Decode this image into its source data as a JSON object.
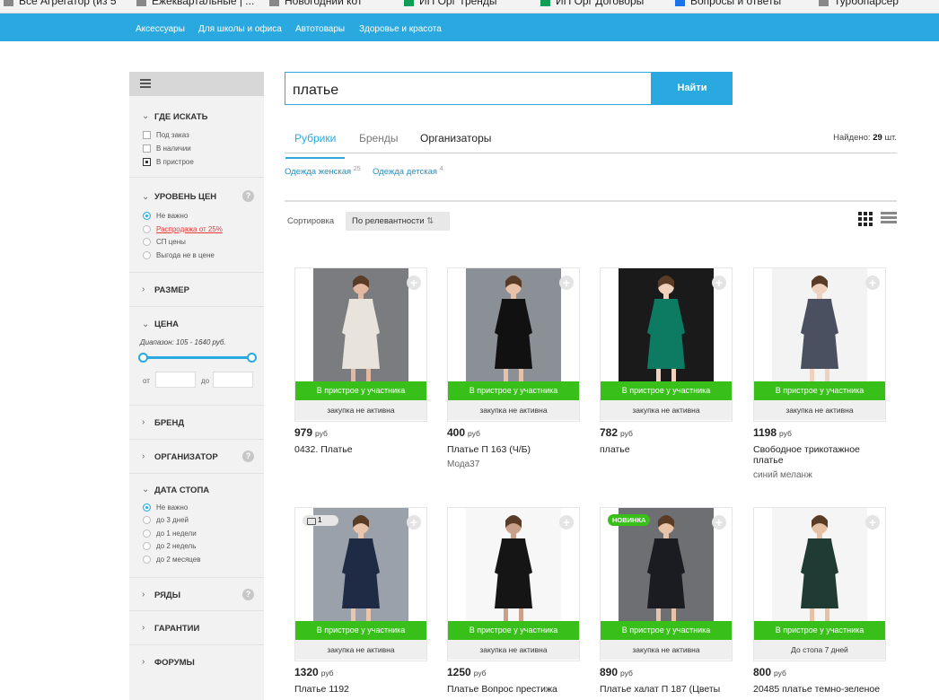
{
  "bookmarks": [
    {
      "label": "Все Агрегатор (из 5",
      "color": "#888"
    },
    {
      "label": "Ежеквартальные | ...",
      "color": "#888"
    },
    {
      "label": "Новогодний кот",
      "color": "#888"
    },
    {
      "label": "ИП Орг Тренды",
      "color": "#0f9d58"
    },
    {
      "label": "ИП Орг Договоры",
      "color": "#0f9d58"
    },
    {
      "label": "Вопросы и ответы",
      "color": "#1a73e8"
    },
    {
      "label": "Турбопарсер",
      "color": "#888"
    }
  ],
  "nav": {
    "items": [
      "Аксессуары",
      "Для школы и офиса",
      "Автотовары",
      "Здоровье и красота"
    ]
  },
  "sidebar": {
    "where": {
      "title": "ГДЕ ИСКАТЬ",
      "options": [
        {
          "label": "Под заказ",
          "checked": false
        },
        {
          "label": "В наличии",
          "checked": false
        },
        {
          "label": "В пристрое",
          "checked": true
        }
      ]
    },
    "price_level": {
      "title": "УРОВЕНЬ ЦЕН",
      "help": "?",
      "options": [
        {
          "label": "Не важно",
          "selected": true
        },
        {
          "label": "Распродажа от 25%",
          "selected": false
        },
        {
          "label": "СП цены",
          "selected": false
        },
        {
          "label": "Выгода не в цене",
          "selected": false
        }
      ]
    },
    "size": {
      "title": "РАЗМЕР"
    },
    "price": {
      "title": "ЦЕНА",
      "range_note": "Диапазон: 105 - 1640 руб.",
      "min": 105,
      "max": 1640,
      "from_label": "от",
      "to_label": "до",
      "from_value": "",
      "to_value": ""
    },
    "brand": {
      "title": "БРЕНД"
    },
    "organizer": {
      "title": "ОРГАНИЗАТОР",
      "help": "?"
    },
    "stop_date": {
      "title": "ДАТА СТОПА",
      "options": [
        {
          "label": "Не важно",
          "selected": true
        },
        {
          "label": "до 3 дней",
          "selected": false
        },
        {
          "label": "до 1 недели",
          "selected": false
        },
        {
          "label": "до 2 недель",
          "selected": false
        },
        {
          "label": "до 2 месяцев",
          "selected": false
        }
      ]
    },
    "rows": {
      "title": "РЯДЫ",
      "help": "?"
    },
    "guarantees": {
      "title": "ГАРАНТИИ"
    },
    "forums": {
      "title": "ФОРУМЫ"
    }
  },
  "search": {
    "value": "платье",
    "button": "Найти"
  },
  "tabs": [
    "Рубрики",
    "Бренды",
    "Организаторы"
  ],
  "found": {
    "label": "Найдено:",
    "count": "29",
    "unit": "шт."
  },
  "rubrics": [
    {
      "label": "Одежда женская",
      "count": "25"
    },
    {
      "label": "Одежда детская",
      "count": "4"
    }
  ],
  "sort": {
    "label": "Сортировка",
    "value": "По релевантности"
  },
  "products": [
    {
      "price": "979",
      "currency": "руб",
      "name": "0432. Платье",
      "extra": "",
      "status": "В пристрое у участника",
      "sub": "закупка не активна",
      "badge": "",
      "photo": {
        "bg": "#7a7c80",
        "dress": "#e8e4dc",
        "skin": "#e2b8a0"
      }
    },
    {
      "price": "400",
      "currency": "руб",
      "name": "Платье П 163 (Ч/Б)",
      "extra": "Мода37",
      "status": "В пристрое у участника",
      "sub": "закупка не активна",
      "badge": "",
      "photo": {
        "bg": "#8b8f96",
        "dress": "#111",
        "skin": "#e7c2a8"
      }
    },
    {
      "price": "782",
      "currency": "руб",
      "name": "платье",
      "extra": "",
      "status": "В пристрое у участника",
      "sub": "закупка не активна",
      "badge": "",
      "photo": {
        "bg": "#1a1a1a",
        "dress": "#0d7a62",
        "skin": "#f0d2bc"
      }
    },
    {
      "price": "1198",
      "currency": "руб",
      "name": "Свободное трикотажное платье",
      "extra": "синий меланж",
      "status": "В пристрое у участника",
      "sub": "закупка не активна",
      "badge": "",
      "photo": {
        "bg": "#f3f3f3",
        "dress": "#4a5060",
        "skin": "#efd2bd"
      }
    },
    {
      "price": "1320",
      "currency": "руб",
      "name": "Платье 1192",
      "extra": "",
      "status": "В пристрое у участника",
      "sub": "закупка не активна",
      "badge": "comments",
      "comments": "1",
      "photo": {
        "bg": "#9aa1aa",
        "dress": "#1f2a44",
        "skin": "#e9c5ac"
      }
    },
    {
      "price": "1250",
      "currency": "руб",
      "name": "Платье Вопрос престижа",
      "extra": "",
      "status": "В пристрое у участника",
      "sub": "закупка не активна",
      "badge": "",
      "photo": {
        "bg": "#f7f7f7",
        "dress": "#151515",
        "skin": "#caa08a"
      }
    },
    {
      "price": "890",
      "currency": "руб",
      "name": "Платье халат П 187 (Цветы",
      "extra": "",
      "status": "В пристрое у участника",
      "sub": "закупка не активна",
      "badge": "new",
      "badge_label": "НОВИНКА",
      "photo": {
        "bg": "#6e6f72",
        "dress": "#1b1b22",
        "skin": "#e8c3a6"
      }
    },
    {
      "price": "800",
      "currency": "руб",
      "name": "20485 платье темно-зеленое",
      "extra": "",
      "status": "В пристрое у участника",
      "sub": "До стопа 7 дней",
      "badge": "",
      "photo": {
        "bg": "#f5f5f5",
        "dress": "#1f3b33",
        "skin": "#e6c1a6"
      }
    }
  ]
}
